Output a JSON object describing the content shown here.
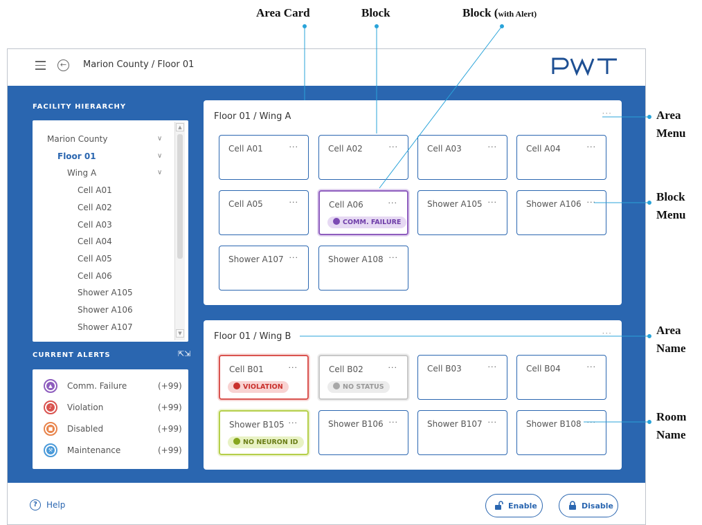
{
  "annotations": {
    "area_card": "Area Card",
    "block": "Block",
    "block_alert_main": "Block (",
    "block_alert_small": "with Alert)",
    "area_menu_1": "Area",
    "area_menu_2": "Menu",
    "block_menu_1": "Block",
    "block_menu_2": "Menu",
    "area_name_1": "Area",
    "area_name_2": "Name",
    "room_name_1": "Room",
    "room_name_2": "Name"
  },
  "header": {
    "breadcrumb": "Marion County / Floor 01",
    "logo": "PWT"
  },
  "hierarchy": {
    "title": "FACILITY HIERARCHY",
    "items": [
      {
        "label": "Marion County",
        "indent": 0,
        "chevron": true,
        "active": false
      },
      {
        "label": "Floor 01",
        "indent": 1,
        "chevron": true,
        "active": true
      },
      {
        "label": "Wing A",
        "indent": 2,
        "chevron": true,
        "active": false
      },
      {
        "label": "Cell A01",
        "indent": 3,
        "chevron": false,
        "active": false
      },
      {
        "label": "Cell A02",
        "indent": 3,
        "chevron": false,
        "active": false
      },
      {
        "label": "Cell A03",
        "indent": 3,
        "chevron": false,
        "active": false
      },
      {
        "label": "Cell A04",
        "indent": 3,
        "chevron": false,
        "active": false
      },
      {
        "label": "Cell A05",
        "indent": 3,
        "chevron": false,
        "active": false
      },
      {
        "label": "Cell A06",
        "indent": 3,
        "chevron": false,
        "active": false
      },
      {
        "label": "Shower A105",
        "indent": 3,
        "chevron": false,
        "active": false
      },
      {
        "label": "Shower A106",
        "indent": 3,
        "chevron": false,
        "active": false
      },
      {
        "label": "Shower A107",
        "indent": 3,
        "chevron": false,
        "active": false
      }
    ]
  },
  "alerts": {
    "title": "CURRENT ALERTS",
    "items": [
      {
        "label": "Comm. Failure",
        "count": "(+99)",
        "color": "#8e5dbe",
        "icon": "warning-triangle-icon"
      },
      {
        "label": "Violation",
        "count": "(+99)",
        "color": "#d9534f",
        "icon": "bell-icon"
      },
      {
        "label": "Disabled",
        "count": "(+99)",
        "color": "#e8834a",
        "icon": "lock-icon"
      },
      {
        "label": "Maintenance",
        "count": "(+99)",
        "color": "#4a9ad9",
        "icon": "wrench-icon"
      }
    ]
  },
  "areas": [
    {
      "title": "Floor 01 / Wing A",
      "blocks": [
        {
          "name": "Cell A01",
          "status": null
        },
        {
          "name": "Cell A02",
          "status": null
        },
        {
          "name": "Cell A03",
          "status": null
        },
        {
          "name": "Cell A04",
          "status": null
        },
        {
          "name": "Cell A05",
          "status": null
        },
        {
          "name": "Cell A06",
          "status": "purple",
          "pill": "COMM. FAILURE",
          "pill_icon": "warning-triangle-icon"
        },
        {
          "name": "Shower A105",
          "status": null
        },
        {
          "name": "Shower A106",
          "status": null
        },
        {
          "name": "Shower A107",
          "status": null
        },
        {
          "name": "Shower A108",
          "status": null
        }
      ]
    },
    {
      "title": "Floor 01 / Wing B",
      "blocks": [
        {
          "name": "Cell B01",
          "status": "red",
          "pill": "VIOLATION",
          "pill_icon": "bell-icon"
        },
        {
          "name": "Cell B02",
          "status": "gray",
          "pill": "NO STATUS",
          "pill_icon": "minus-circle-icon"
        },
        {
          "name": "Cell B03",
          "status": null
        },
        {
          "name": "Cell B04",
          "status": null
        },
        {
          "name": "Shower B105",
          "status": "lime",
          "pill": "NO NEURON ID",
          "pill_icon": "minus-circle-icon"
        },
        {
          "name": "Shower B106",
          "status": null
        },
        {
          "name": "Shower B107",
          "status": null
        },
        {
          "name": "Shower B108",
          "status": null
        }
      ]
    }
  ],
  "menu_glyph": "···",
  "footer": {
    "help": "Help",
    "enable": "Enable",
    "disable": "Disable"
  },
  "colors": {
    "brand_blue": "#2a66b0",
    "comm_failure": "#8e5dbe",
    "violation": "#d9534f",
    "disabled": "#e8834a",
    "maintenance": "#4a9ad9",
    "no_neuron": "#b5cf4a"
  }
}
